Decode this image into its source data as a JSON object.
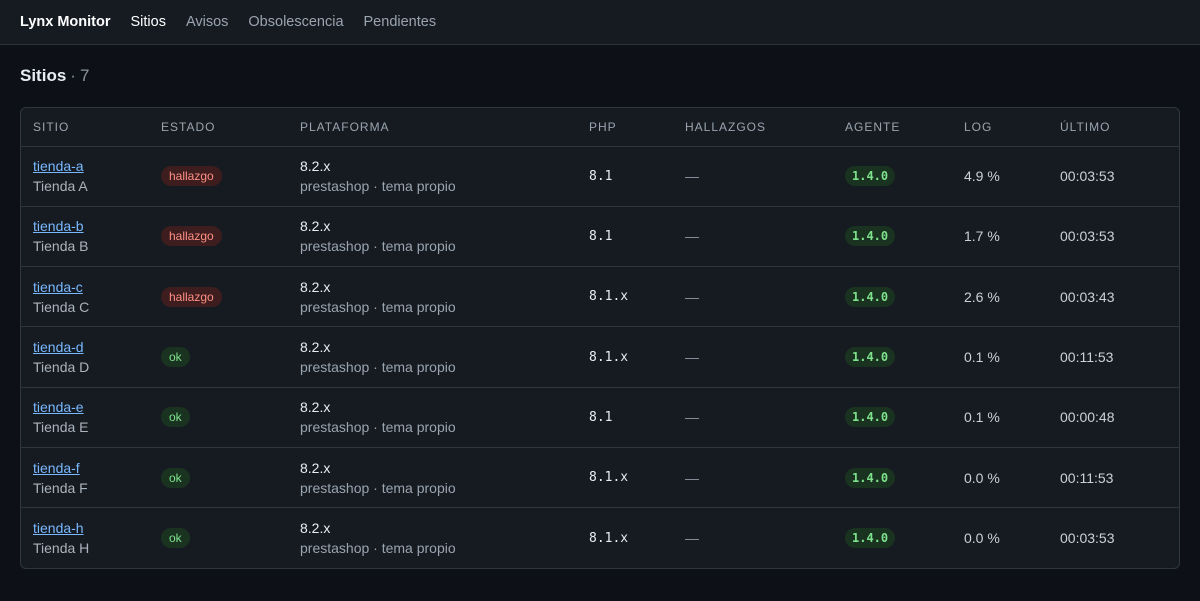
{
  "nav": {
    "brand": "Lynx Monitor",
    "items": [
      {
        "label": "Sitios",
        "active": true
      },
      {
        "label": "Avisos",
        "active": false
      },
      {
        "label": "Obsolescencia",
        "active": false
      },
      {
        "label": "Pendientes",
        "active": false
      }
    ]
  },
  "page": {
    "title": "Sitios",
    "separator": "·",
    "count": "7"
  },
  "table": {
    "columns": [
      "SITIO",
      "ESTADO",
      "PLATAFORMA",
      "PHP",
      "HALLAZGOS",
      "AGENTE",
      "LOG",
      "ÚLTIMO"
    ],
    "rows": [
      {
        "slug": "tienda-a",
        "name": "Tienda A",
        "estado": "hallazgo",
        "plat_version": "8.2.x",
        "plat_desc": "prestashop · tema propio",
        "php": "8.1",
        "hallazgos": "—",
        "agente": "1.4.0",
        "log": "4.9 %",
        "ultimo": "00:03:53"
      },
      {
        "slug": "tienda-b",
        "name": "Tienda B",
        "estado": "hallazgo",
        "plat_version": "8.2.x",
        "plat_desc": "prestashop · tema propio",
        "php": "8.1",
        "hallazgos": "—",
        "agente": "1.4.0",
        "log": "1.7 %",
        "ultimo": "00:03:53"
      },
      {
        "slug": "tienda-c",
        "name": "Tienda C",
        "estado": "hallazgo",
        "plat_version": "8.2.x",
        "plat_desc": "prestashop · tema propio",
        "php": "8.1.x",
        "hallazgos": "—",
        "agente": "1.4.0",
        "log": "2.6 %",
        "ultimo": "00:03:43"
      },
      {
        "slug": "tienda-d",
        "name": "Tienda D",
        "estado": "ok",
        "plat_version": "8.2.x",
        "plat_desc": "prestashop · tema propio",
        "php": "8.1.x",
        "hallazgos": "—",
        "agente": "1.4.0",
        "log": "0.1 %",
        "ultimo": "00:11:53"
      },
      {
        "slug": "tienda-e",
        "name": "Tienda E",
        "estado": "ok",
        "plat_version": "8.2.x",
        "plat_desc": "prestashop · tema propio",
        "php": "8.1",
        "hallazgos": "—",
        "agente": "1.4.0",
        "log": "0.1 %",
        "ultimo": "00:00:48"
      },
      {
        "slug": "tienda-f",
        "name": "Tienda F",
        "estado": "ok",
        "plat_version": "8.2.x",
        "plat_desc": "prestashop · tema propio",
        "php": "8.1.x",
        "hallazgos": "—",
        "agente": "1.4.0",
        "log": "0.0 %",
        "ultimo": "00:11:53"
      },
      {
        "slug": "tienda-h",
        "name": "Tienda H",
        "estado": "ok",
        "plat_version": "8.2.x",
        "plat_desc": "prestashop · tema propio",
        "php": "8.1.x",
        "hallazgos": "—",
        "agente": "1.4.0",
        "log": "0.0 %",
        "ultimo": "00:03:53"
      }
    ]
  },
  "colors": {
    "background": "#0d1117",
    "link": "#79b8ff",
    "status_hallazgo": "#ff8f85",
    "status_ok": "#7ee28d"
  }
}
